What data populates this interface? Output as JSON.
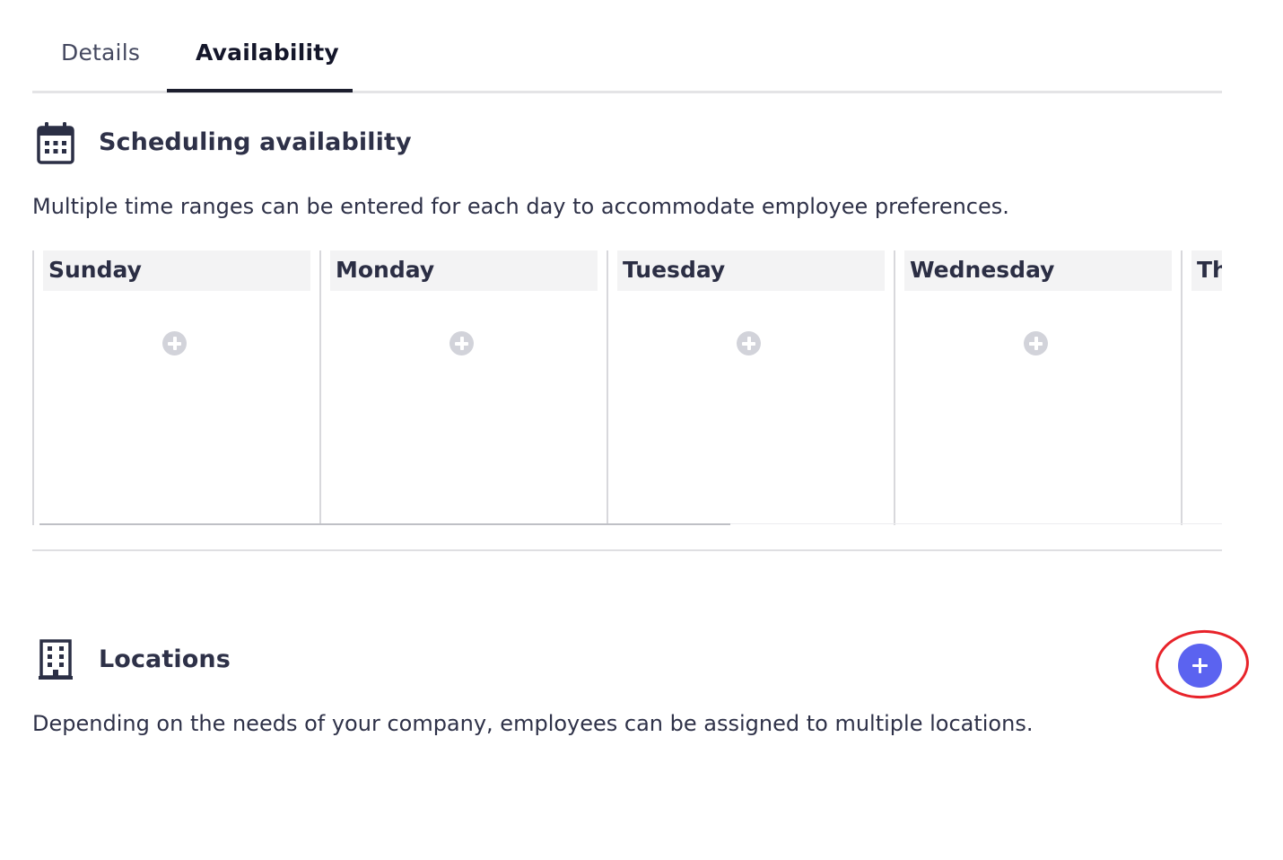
{
  "tabs": [
    {
      "label": "Details",
      "active": false
    },
    {
      "label": "Availability",
      "active": true
    }
  ],
  "availability": {
    "icon": "calendar-icon",
    "title": "Scheduling availability",
    "description": "Multiple time ranges can be entered for each day to accommodate employee preferences.",
    "days": [
      {
        "label": "Sunday"
      },
      {
        "label": "Monday"
      },
      {
        "label": "Tuesday"
      },
      {
        "label": "Wednesday"
      },
      {
        "label": "Th"
      }
    ],
    "add_slot_icon": "plus-circle-icon"
  },
  "locations": {
    "icon": "building-icon",
    "title": "Locations",
    "description": "Depending on the needs of your company, employees can be assigned to multiple locations.",
    "add_button_icon": "plus-icon",
    "add_button_color": "#5b63f0",
    "highlight_color": "#e8232a"
  },
  "colors": {
    "accent": "#5b63f0",
    "text": "#2e3148",
    "header_bg": "#f3f3f4"
  }
}
